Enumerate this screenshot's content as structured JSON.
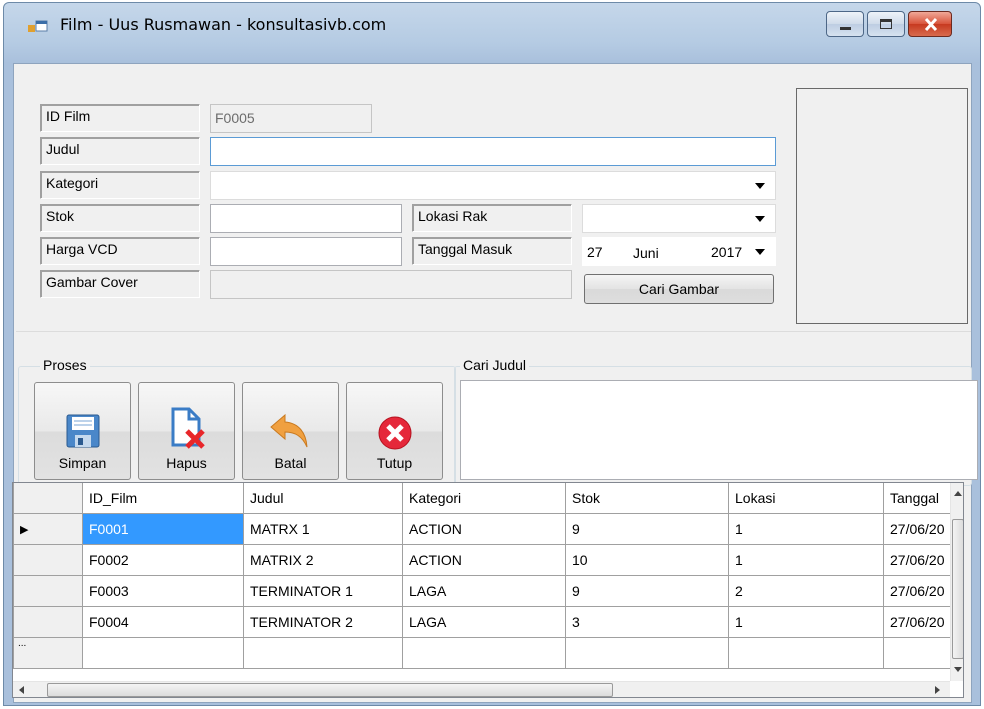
{
  "window": {
    "title": "Film - Uus Rusmawan - konsultasivb.com",
    "controls": [
      "minimize-icon",
      "maximize-icon",
      "close-icon"
    ]
  },
  "form": {
    "labels": {
      "id_film": "ID Film",
      "judul": "Judul",
      "kategori": "Kategori",
      "stok": "Stok",
      "harga_vcd": "Harga VCD",
      "gambar_cover": "Gambar Cover",
      "lokasi_rak": "Lokasi Rak",
      "tanggal_masuk": "Tanggal Masuk"
    },
    "values": {
      "id_film": "F0005",
      "judul": "",
      "kategori": "",
      "stok": "",
      "harga_vcd": "",
      "gambar_cover": "",
      "lokasi_rak": ""
    },
    "date": {
      "day": "27",
      "month": "Juni",
      "year": "2017"
    },
    "cari_gambar_label": "Cari Gambar"
  },
  "proses": {
    "title": "Proses",
    "buttons": {
      "simpan": "Simpan",
      "hapus": "Hapus",
      "batal": "Batal",
      "tutup": "Tutup"
    }
  },
  "cari_judul": {
    "title": "Cari Judul",
    "value": ""
  },
  "grid": {
    "columns": [
      "ID_Film",
      "Judul",
      "Kategori",
      "Stok",
      "Lokasi",
      "Tanggal"
    ],
    "rows": [
      [
        "F0001",
        "MATRX 1",
        "ACTION",
        "9",
        "1",
        "27/06/20"
      ],
      [
        "F0002",
        "MATRIX 2",
        "ACTION",
        "10",
        "1",
        "27/06/20"
      ],
      [
        "F0003",
        "TERMINATOR 1",
        "LAGA",
        "9",
        "2",
        "27/06/20"
      ],
      [
        "F0004",
        "TERMINATOR 2",
        "LAGA",
        "3",
        "1",
        "27/06/20"
      ]
    ],
    "current_row_marker": "▶",
    "new_row_marker": "..."
  },
  "colors": {
    "selection": "#3399ff",
    "title_gradient": "#c5d7ea",
    "close_red": "#c73a20"
  }
}
